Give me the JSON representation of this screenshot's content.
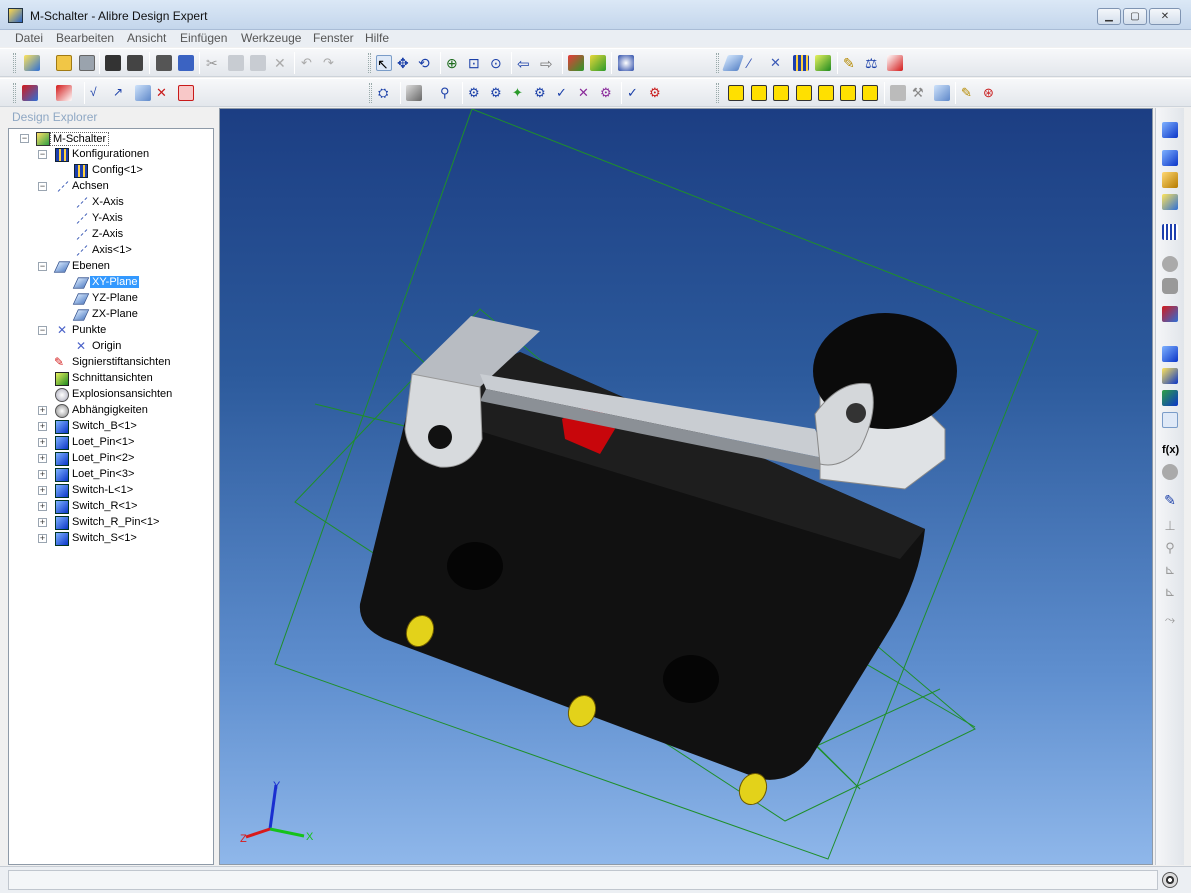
{
  "window": {
    "title": "M-Schalter - Alibre Design Expert"
  },
  "menu": [
    "Datei",
    "Bearbeiten",
    "Ansicht",
    "Einfügen",
    "Werkzeuge",
    "Fenster",
    "Hilfe"
  ],
  "explorer": {
    "title": "Design Explorer",
    "tree": [
      {
        "label": "M-Schalter",
        "toggle": "−",
        "icon": "assembly-icon"
      },
      {
        "label": "Konfigurationen",
        "toggle": "−",
        "icon": "configurations-icon"
      },
      {
        "label": "Config<1>",
        "icon": "config-icon"
      },
      {
        "label": "Achsen",
        "toggle": "−",
        "icon": "axes-icon"
      },
      {
        "label": "X-Axis",
        "icon": "axis-icon"
      },
      {
        "label": "Y-Axis",
        "icon": "axis-icon"
      },
      {
        "label": "Z-Axis",
        "icon": "axis-icon"
      },
      {
        "label": "Axis<1>",
        "icon": "axis-icon"
      },
      {
        "label": "Ebenen",
        "toggle": "−",
        "icon": "planes-icon"
      },
      {
        "label": "XY-Plane",
        "icon": "plane-icon",
        "selected": true
      },
      {
        "label": "YZ-Plane",
        "icon": "plane-icon"
      },
      {
        "label": "ZX-Plane",
        "icon": "plane-icon"
      },
      {
        "label": "Punkte",
        "toggle": "−",
        "icon": "points-icon"
      },
      {
        "label": "Origin",
        "icon": "origin-icon"
      },
      {
        "label": "Signierstiftansichten",
        "icon": "marker-views-icon"
      },
      {
        "label": "Schnittansichten",
        "icon": "section-views-icon"
      },
      {
        "label": "Explosionsansichten",
        "icon": "exploded-views-icon"
      },
      {
        "label": "Abhängigkeiten",
        "toggle": "+",
        "icon": "constraints-icon"
      },
      {
        "label": "Switch_B<1>",
        "toggle": "+",
        "icon": "part-icon"
      },
      {
        "label": "Loet_Pin<1>",
        "toggle": "+",
        "icon": "part-icon"
      },
      {
        "label": "Loet_Pin<2>",
        "toggle": "+",
        "icon": "part-icon"
      },
      {
        "label": "Loet_Pin<3>",
        "toggle": "+",
        "icon": "part-icon"
      },
      {
        "label": "Switch-L<1>",
        "toggle": "+",
        "icon": "part-icon"
      },
      {
        "label": "Switch_R<1>",
        "toggle": "+",
        "icon": "part-icon"
      },
      {
        "label": "Switch_R_Pin<1>",
        "toggle": "+",
        "icon": "part-icon"
      },
      {
        "label": "Switch_S<1>",
        "toggle": "+",
        "icon": "part-icon"
      }
    ]
  },
  "triad": {
    "x": "X",
    "y": "Y",
    "z": "Z"
  },
  "colors": {
    "viewport_top": "#1c3e83",
    "viewport_bottom": "#8fb7ea",
    "plane_lines": "#1f8f2a",
    "switch_body": "#111111",
    "lever": "#c9cdd2",
    "plunger": "#c8060b",
    "pins": "#e3d21a",
    "selection": "#3399ff"
  },
  "toolbar_icons": {
    "row1": [
      "new-icon",
      "open-icon",
      "save-icon",
      "cut-icon",
      "copy-icon",
      "paste-icon",
      "delete-icon",
      "undo-icon",
      "redo-icon",
      "select-icon",
      "move-icon",
      "rotate-icon",
      "zoom-in-icon",
      "zoom-window-icon",
      "zoom-fit-icon",
      "previous-view-icon",
      "next-view-icon",
      "plane-tool-icon",
      "axis-tool-icon",
      "point-tool-icon",
      "table-icon",
      "part-tool-icon",
      "measure-icon",
      "mass-properties-icon",
      "interference-icon"
    ],
    "row2": [
      "view-cube-icon",
      "shading-icon",
      "display-mode-icon",
      "constraint-icons",
      "standard-views-icons",
      "sketch-icon",
      "analyze-icon"
    ]
  }
}
